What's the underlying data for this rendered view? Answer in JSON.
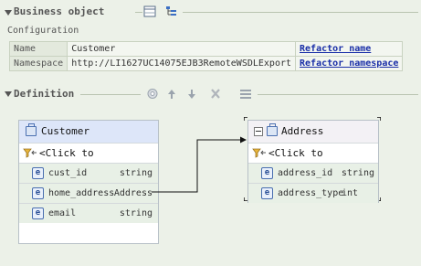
{
  "business_object": {
    "title": "Business object",
    "configuration_label": "Configuration",
    "rows": [
      {
        "name": "Name",
        "value": "Customer",
        "action": "Refactor name"
      },
      {
        "name": "Namespace",
        "value": "http://LI1627UC14075EJB3RemoteWSDLExport",
        "action": "Refactor namespace"
      }
    ]
  },
  "definition": {
    "title": "Definition",
    "customer": {
      "title": "Customer",
      "filter": "Click to filter...",
      "fields": [
        {
          "name": "cust_id",
          "type": "string"
        },
        {
          "name": "home_address",
          "type": "Address"
        },
        {
          "name": "email",
          "type": "string"
        }
      ]
    },
    "address": {
      "title": "Address",
      "filter": "Click to filter...",
      "fields": [
        {
          "name": "address_id",
          "type": "string"
        },
        {
          "name": "address_type",
          "type": "int"
        }
      ]
    }
  },
  "icons": {
    "field": "e",
    "filter_left": "<",
    "filter_right": ">"
  },
  "colors": {
    "background": "#ecf1e8",
    "link": "#1a2fa8",
    "customer_header": "#dde6f9",
    "address_header": "#f3f1f5",
    "row": "#e8f0e6"
  }
}
